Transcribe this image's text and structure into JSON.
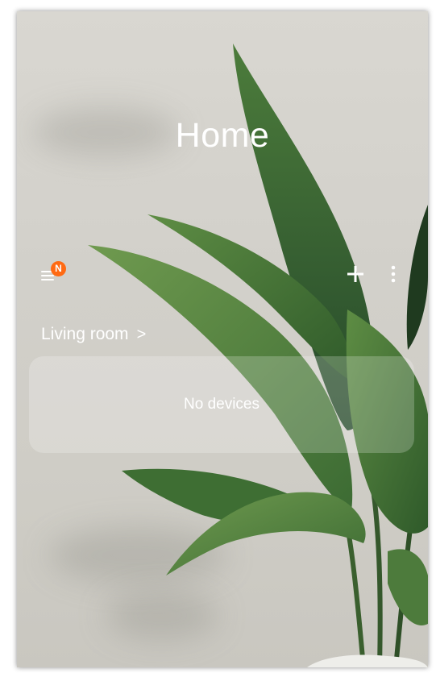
{
  "home": {
    "title": "Home",
    "menu_badge": "N"
  },
  "room": {
    "name": "Living room",
    "chevron": ">"
  },
  "devices": {
    "empty_text": "No devices"
  },
  "icons": {
    "menu": "menu-icon",
    "add": "plus-icon",
    "more": "more-vertical-icon"
  },
  "colors": {
    "badge": "#ff6a13",
    "text": "#ffffff",
    "background": "#d6d4ce",
    "leaf": "#3f6a35"
  }
}
